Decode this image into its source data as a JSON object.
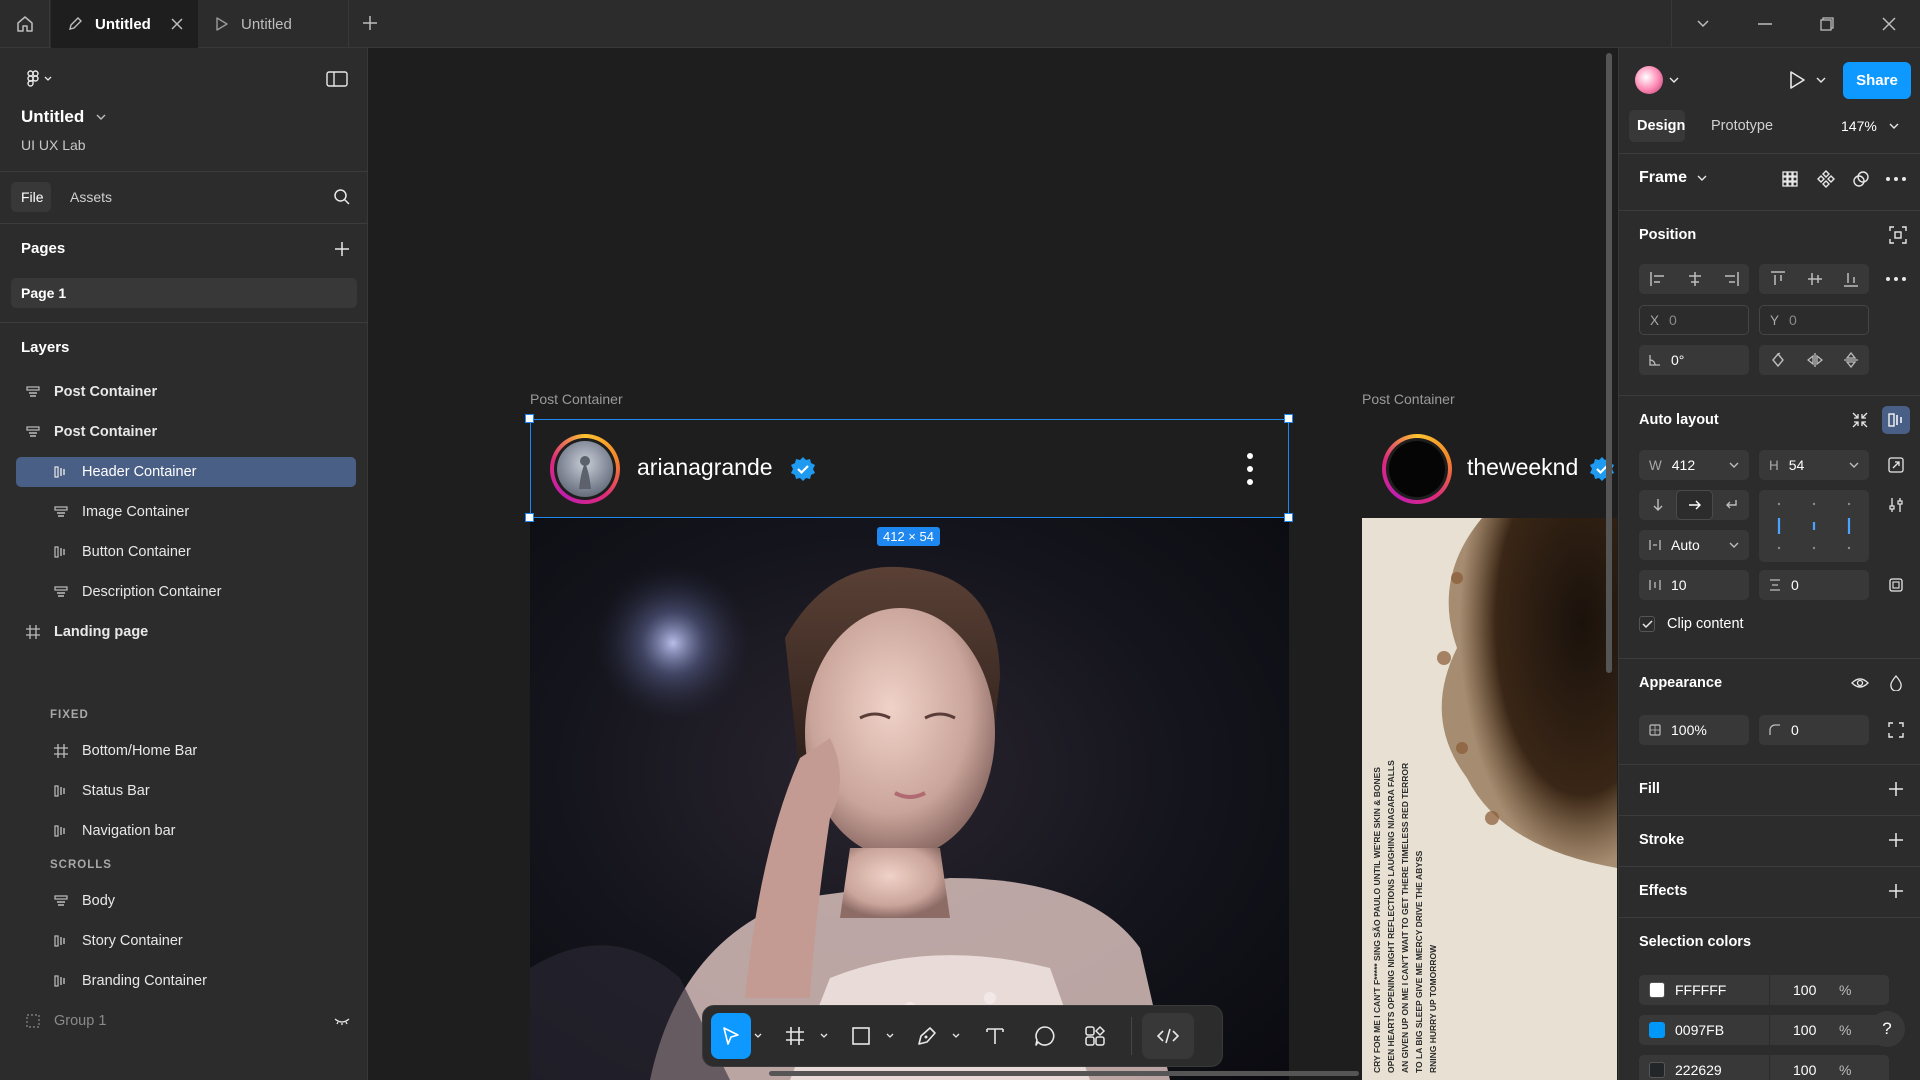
{
  "tabs": [
    {
      "label": "Untitled",
      "active": true
    },
    {
      "label": "Untitled",
      "active": false
    }
  ],
  "file": {
    "name": "Untitled",
    "team": "UI UX Lab"
  },
  "left_tabs": {
    "file": "File",
    "assets": "Assets"
  },
  "pages": {
    "title": "Pages",
    "items": [
      "Page 1"
    ]
  },
  "layers": {
    "title": "Layers",
    "items": [
      {
        "label": "Post Container",
        "icon": "autolayout-vertical-icon"
      },
      {
        "label": "Post Container",
        "icon": "autolayout-vertical-icon"
      },
      {
        "label": "Header Container",
        "icon": "autolayout-horizontal-icon",
        "selected": true
      },
      {
        "label": "Image Container",
        "icon": "autolayout-vertical-icon"
      },
      {
        "label": "Button Container",
        "icon": "autolayout-horizontal-icon"
      },
      {
        "label": "Description Container",
        "icon": "autolayout-vertical-icon"
      },
      {
        "label": "Landing page",
        "icon": "frame-icon"
      },
      {
        "label": "Bottom/Home Bar",
        "icon": "frame-icon"
      },
      {
        "label": "Status Bar",
        "icon": "autolayout-horizontal-icon"
      },
      {
        "label": "Navigation bar",
        "icon": "autolayout-horizontal-icon"
      },
      {
        "label": "Body",
        "icon": "autolayout-vertical-icon"
      },
      {
        "label": "Story Container",
        "icon": "autolayout-horizontal-icon"
      },
      {
        "label": "Branding Container",
        "icon": "autolayout-horizontal-icon"
      },
      {
        "label": "Group 1",
        "icon": "group-icon",
        "hidden": true
      }
    ],
    "groups": {
      "fixed": "FIXED",
      "scrolls": "SCROLLS"
    }
  },
  "canvas": {
    "frames": [
      {
        "label": "Post Container",
        "username": "arianagrande"
      },
      {
        "label": "Post Container",
        "username": "theweeknd"
      }
    ],
    "selection_size": "412 × 54",
    "poster_text": [
      "CRY FOR ME  I CAN'T F***** SING  SÃO PAULO  UNTIL WE'RE SKIN & BONES",
      "OPEN HEARTS  OPENING NIGHT  REFLECTIONS LAUGHING  NIAGARA FALLS",
      "AN  GIVEN UP ON ME  I CAN'T WAIT TO GET THERE  TIMELESS  RED TERROR",
      "TO LA  BIG SLEEP  GIVE ME MERCY  DRIVE  THE ABYSS",
      "RNING  HURRY UP TOMORROW"
    ]
  },
  "right": {
    "tabs": {
      "design": "Design",
      "prototype": "Prototype"
    },
    "zoom": "147%",
    "share": "Share",
    "frame_label": "Frame",
    "position": {
      "title": "Position",
      "x": "0",
      "y": "0",
      "rotation": "0°",
      "x_label": "X",
      "y_label": "Y"
    },
    "auto_layout": {
      "title": "Auto layout",
      "w_label": "W",
      "w": "412",
      "h_label": "H",
      "h": "54",
      "gap_mode": "Auto",
      "padding_h": "10",
      "padding_v": "0",
      "clip": "Clip content"
    },
    "appearance": {
      "title": "Appearance",
      "opacity": "100%",
      "radius": "0"
    },
    "fill": "Fill",
    "stroke": "Stroke",
    "effects": "Effects",
    "selection_colors": {
      "title": "Selection colors",
      "items": [
        {
          "hex": "FFFFFF",
          "opacity": "100",
          "unit": "%",
          "color": "#FFFFFF"
        },
        {
          "hex": "0097FB",
          "opacity": "100",
          "unit": "%",
          "color": "#0097FB"
        },
        {
          "hex": "222629",
          "opacity": "100",
          "unit": "%",
          "color": "#222629"
        }
      ]
    },
    "help": "?"
  },
  "colors": {
    "accent": "#0d99ff",
    "selection": "#1e88f0",
    "panel": "#2c2c2c",
    "canvas": "#1e1e1e"
  }
}
